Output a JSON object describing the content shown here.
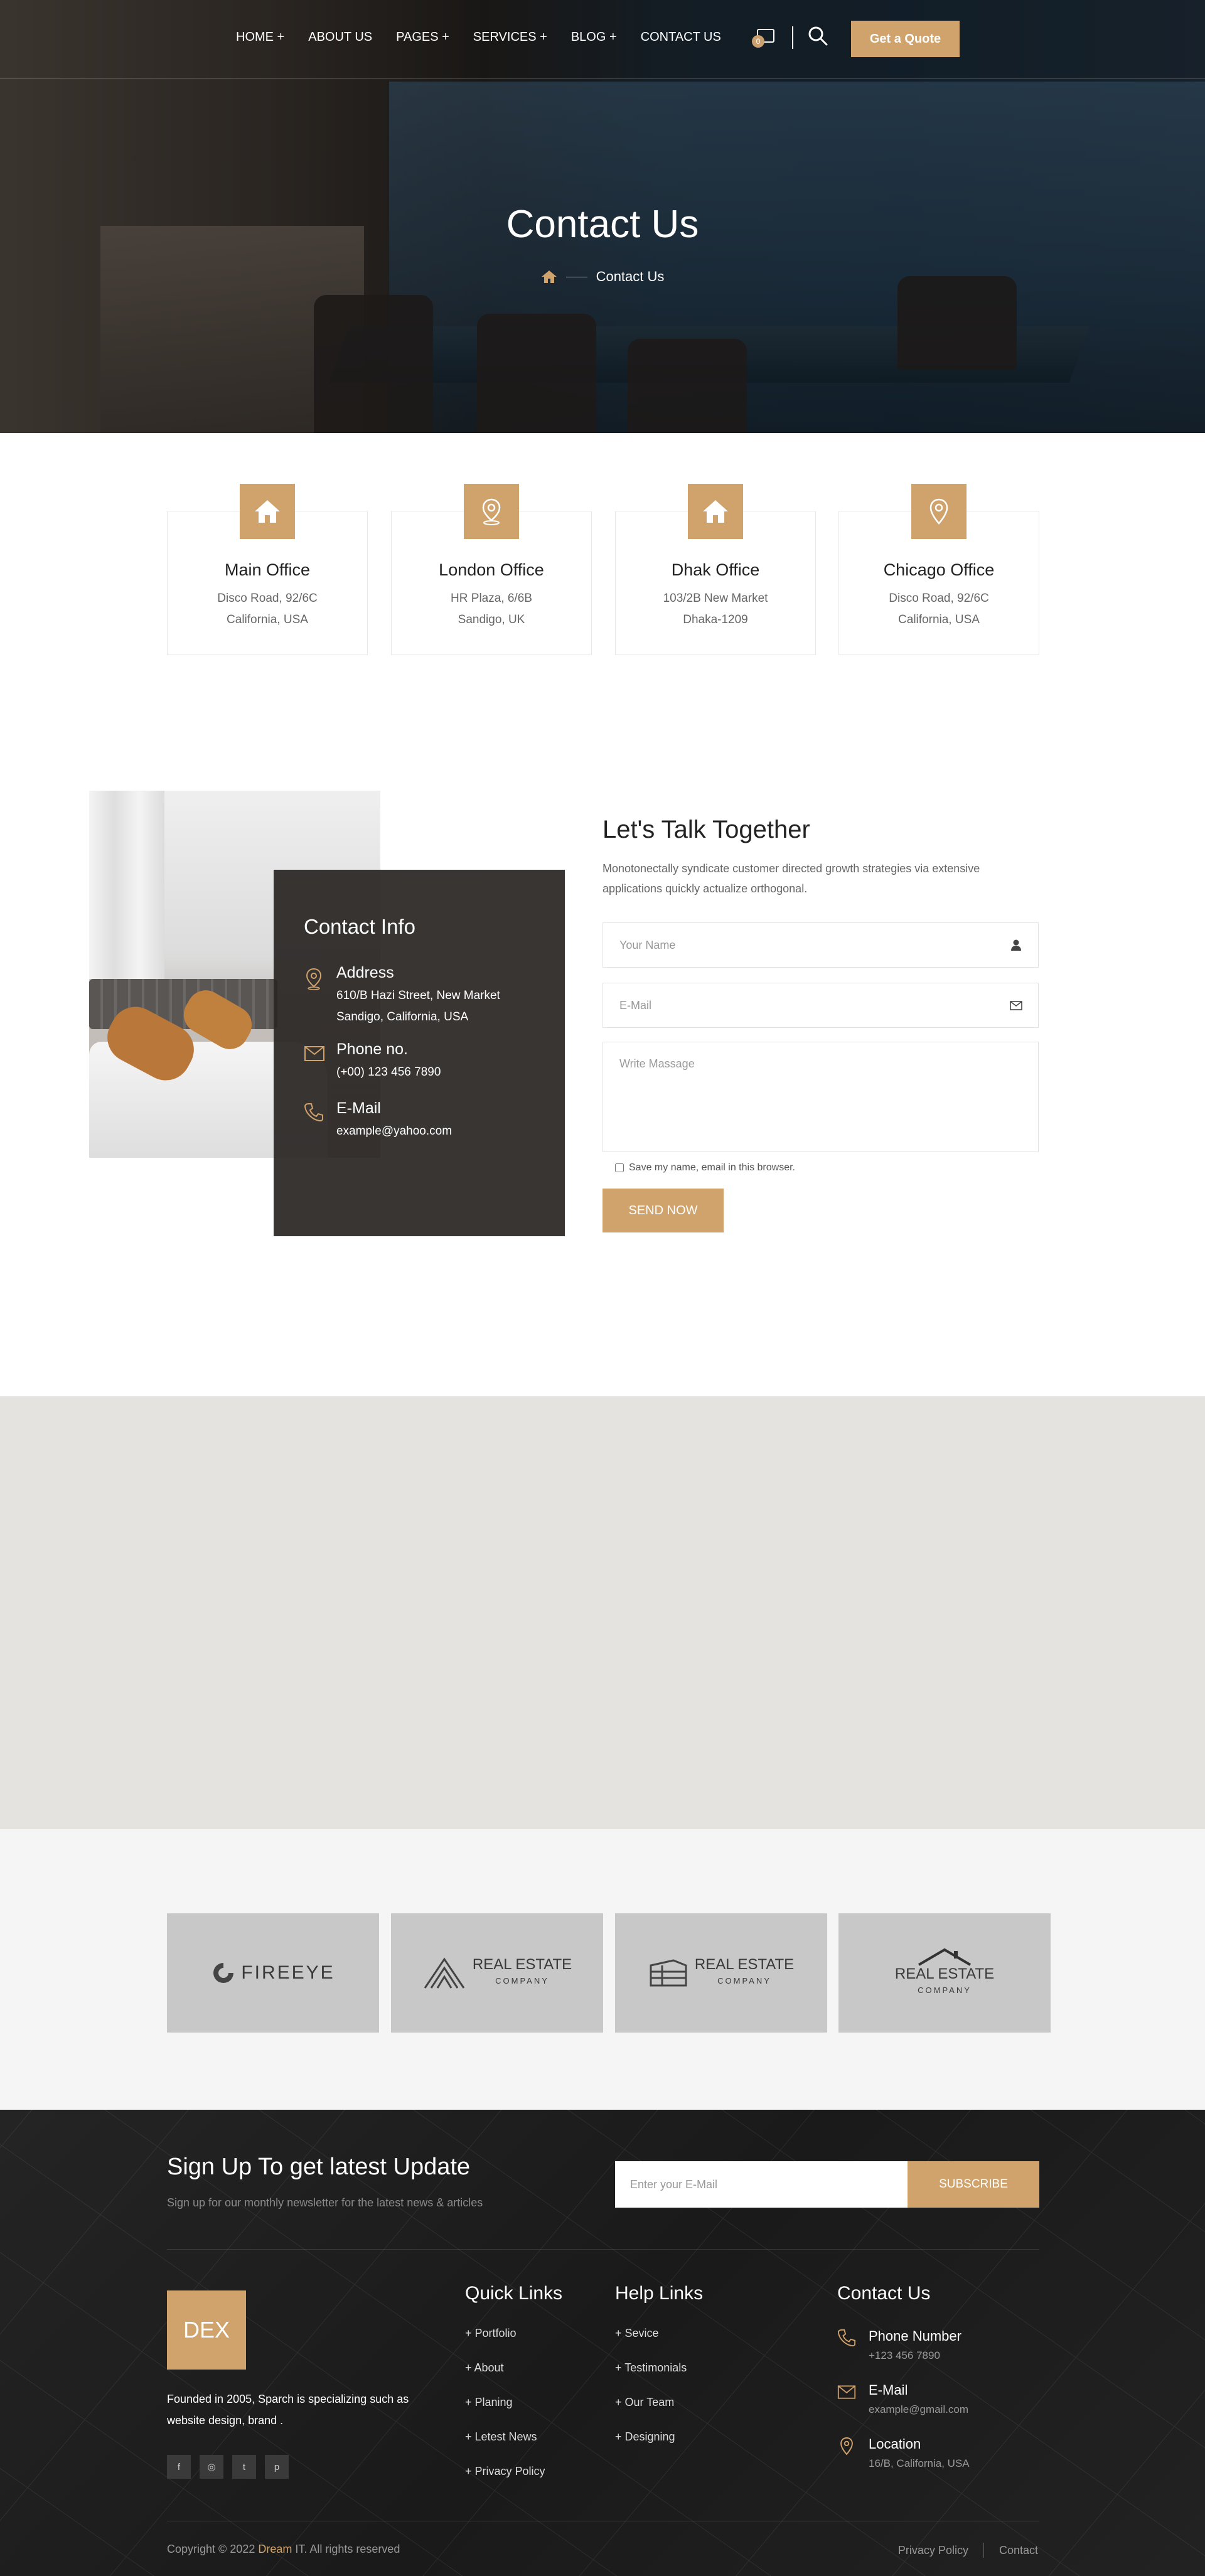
{
  "nav": {
    "items": [
      "HOME +",
      "ABOUT US",
      "PAGES +",
      "SERVICES +",
      "BLOG +",
      "CONTACT US"
    ],
    "cart_count": "0",
    "quote_label": "Get a Quote"
  },
  "hero": {
    "title": "Contact Us",
    "breadcrumb_current": "Contact Us"
  },
  "offices": [
    {
      "name": "Main Office",
      "line1": "Disco Road, 92/6C",
      "line2": "California, USA",
      "icon": "home-icon"
    },
    {
      "name": "London Office",
      "line1": "HR Plaza, 6/6B",
      "line2": "Sandigo, UK",
      "icon": "location-icon"
    },
    {
      "name": "Dhak Office",
      "line1": "103/2B New Market",
      "line2": "Dhaka-1209",
      "icon": "home-icon"
    },
    {
      "name": "Chicago Office",
      "line1": "Disco Road, 92/6C",
      "line2": "California, USA",
      "icon": "map-pin-icon"
    }
  ],
  "contact_info": {
    "title": "Contact Info",
    "address_label": "Address",
    "address_line1": "610/B Hazi Street, New Market",
    "address_line2": "Sandigo, California, USA",
    "phone_label": "Phone no.",
    "phone_value": "(+00) 123 456 7890",
    "email_label": "E-Mail",
    "email_value": "example@yahoo.com"
  },
  "form": {
    "title": "Let's Talk Together",
    "description": "Monotonectally syndicate customer directed growth strategies via extensive applications quickly actualize orthogonal.",
    "name_placeholder": "Your Name",
    "email_placeholder": "E-Mail",
    "message_placeholder": "Write Massage",
    "save_label": "Save my name, email in this browser.",
    "send_label": "SEND NOW"
  },
  "partners": [
    {
      "name": "FIREEYE",
      "sub": ""
    },
    {
      "name": "REAL ESTATE",
      "sub": "COMPANY"
    },
    {
      "name": "REAL ESTATE",
      "sub": "COMPANY"
    },
    {
      "name": "REAL ESTATE",
      "sub": "COMPANY"
    }
  ],
  "newsletter": {
    "title": "Sign Up To get latest Update",
    "subtitle": "Sign up for our monthly newsletter for the latest news & articles",
    "placeholder": "Enter your E-Mail",
    "button": "SUBSCRIBE"
  },
  "footer": {
    "logo": "DEX",
    "about": "Founded in 2005, Sparch is specializing such as website design, brand .",
    "socials": [
      "f",
      "◎",
      "t",
      "p"
    ],
    "quick_links_title": "Quick Links",
    "quick_links": [
      "+ Portfolio",
      "+ About",
      "+ Planing",
      "+ Letest News",
      "+ Privacy Policy"
    ],
    "help_links_title": "Help Links",
    "help_links": [
      "+ Sevice",
      "+ Testimonials",
      "+ Our Team",
      "+ Designing"
    ],
    "contact_title": "Contact Us",
    "phone_label": "Phone Number",
    "phone_value": "+123 456 7890",
    "email_label": "E-Mail",
    "email_value": "example@gmail.com",
    "location_label": "Location",
    "location_value": "16/B, California, USA",
    "copyright_prefix": "Copyright © 2022 ",
    "copyright_brand": "Dream",
    "copyright_suffix": " IT. All rights reserved",
    "privacy": "Privacy Policy",
    "contact": "Contact"
  },
  "colors": {
    "accent": "#d0a26c",
    "dark": "#1e1e1e"
  }
}
